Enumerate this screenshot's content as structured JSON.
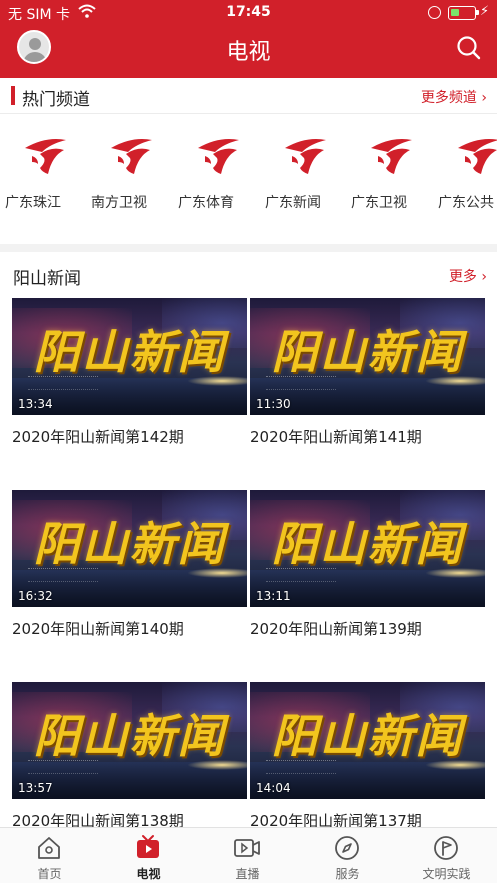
{
  "status_bar": {
    "carrier": "无 SIM 卡",
    "time": "17:45",
    "battery_level": 0.35
  },
  "header": {
    "title": "电视"
  },
  "hot_channels": {
    "title": "热门频道",
    "more_label": "更多频道 ›",
    "channels": [
      {
        "name": "广东珠江"
      },
      {
        "name": "南方卫视"
      },
      {
        "name": "广东体育"
      },
      {
        "name": "广东新闻"
      },
      {
        "name": "广东卫视"
      },
      {
        "name": "广东公共"
      }
    ]
  },
  "news": {
    "title": "阳山新闻",
    "more_label": "更多 ›",
    "thumb_logo": "阳山新闻",
    "items": [
      {
        "duration": "13:34",
        "caption": "2020年阳山新闻第142期"
      },
      {
        "duration": "11:30",
        "caption": "2020年阳山新闻第141期"
      },
      {
        "duration": "16:32",
        "caption": "2020年阳山新闻第140期"
      },
      {
        "duration": "13:11",
        "caption": "2020年阳山新闻第139期"
      },
      {
        "duration": "13:57",
        "caption": "2020年阳山新闻第138期"
      },
      {
        "duration": "14:04",
        "caption": "2020年阳山新闻第137期"
      }
    ]
  },
  "tabbar": {
    "tabs": [
      {
        "label": "首页",
        "icon": "home-icon"
      },
      {
        "label": "电视",
        "icon": "tv-icon",
        "active": true
      },
      {
        "label": "直播",
        "icon": "live-video-icon"
      },
      {
        "label": "服务",
        "icon": "compass-icon"
      },
      {
        "label": "文明实践",
        "icon": "flag-icon"
      }
    ]
  },
  "colors": {
    "brand_red": "#d1202a",
    "battery_green": "#7be36a",
    "thumb_gold": "#f2c51e"
  }
}
